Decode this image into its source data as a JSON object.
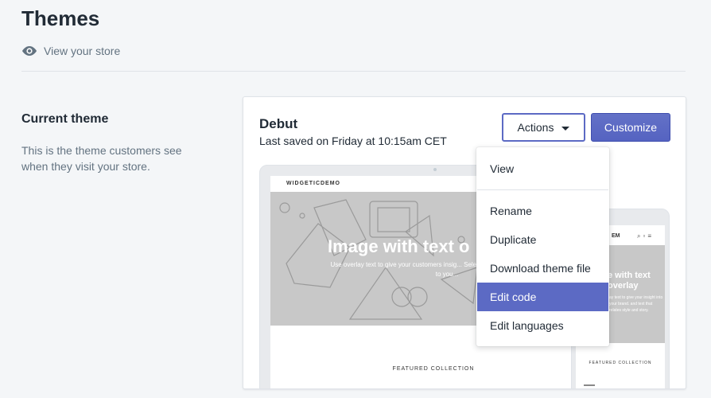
{
  "header": {
    "title": "Themes",
    "view_store_label": "View your store"
  },
  "section": {
    "title": "Current theme",
    "description": "This is the theme customers see when they visit your store."
  },
  "theme": {
    "name": "Debut",
    "last_saved": "Last saved on Friday at 10:15am CET",
    "actions_label": "Actions",
    "customize_label": "Customize"
  },
  "preview": {
    "store_name": "WIDGETICDEMO",
    "hero_title": "Image with text o",
    "hero_subtitle": "Use overlay text to give your customers insig... Select imagery and text that relates to you...",
    "featured_label": "FEATURED COLLECTION",
    "phone_store_name": "EM",
    "phone_hero_title": "e with text overlay",
    "phone_hero_subtitle": "ay text to give your insight into your brand. and text that relates style and story.",
    "phone_featured_label": "FEATURED COLLECTION"
  },
  "actions_menu": {
    "items": [
      {
        "label": "View"
      },
      {
        "label": "Rename"
      },
      {
        "label": "Duplicate"
      },
      {
        "label": "Download theme file"
      },
      {
        "label": "Edit code",
        "active": true
      },
      {
        "label": "Edit languages"
      }
    ]
  },
  "colors": {
    "accent": "#5c6ac4",
    "background": "#f4f6f8",
    "text": "#212b36",
    "muted_text": "#637381"
  }
}
